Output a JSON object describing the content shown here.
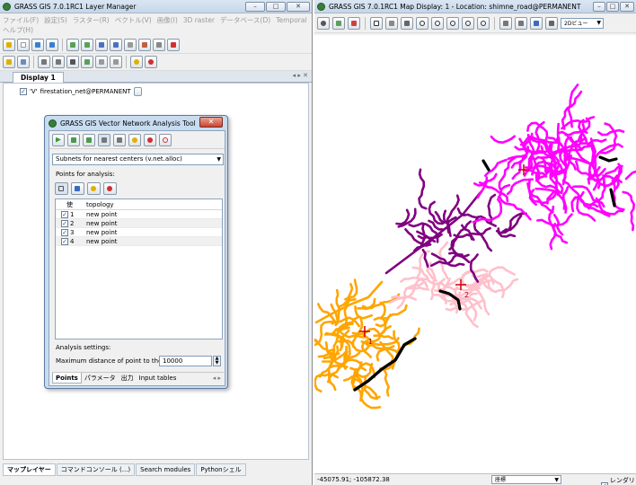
{
  "layer_manager": {
    "title": "GRASS GIS 7.0.1RC1 Layer Manager",
    "menu": [
      "ファイル(F)",
      "設定(S)",
      "ラスター(R)",
      "ベクトル(V)",
      "画像(I)",
      "3D raster",
      "データベース(D)",
      "Temporal",
      "ヘルプ(H)"
    ],
    "display_tab": "Display 1",
    "tab_controls": "◂ ▸ ✕",
    "layer": {
      "checked": "✓",
      "type": "'V'",
      "name": "firestation_net@PERMANENT"
    },
    "bottom_tabs": [
      "マップレイヤー",
      "コマンドコンソール (...)",
      "Search modules",
      "Pythonシェル"
    ]
  },
  "dialog": {
    "title": "GRASS GIS Vector Network Analysis Tool",
    "close": "✕",
    "analysis_select": "Subnets for nearest centers (v.net.alloc)",
    "points_label": "Points for analysis:",
    "columns": [
      "使",
      "topology"
    ],
    "points": [
      {
        "id": "1",
        "topology": "new point"
      },
      {
        "id": "2",
        "topology": "new point"
      },
      {
        "id": "3",
        "topology": "new point"
      },
      {
        "id": "4",
        "topology": "new point"
      }
    ],
    "settings_label": "Analysis settings:",
    "max_dist_label": "Maximum distance of point to the",
    "max_dist_value": "10000",
    "tabs": [
      "Points",
      "パラメータ",
      "出力",
      "Input tables"
    ]
  },
  "map_display": {
    "title": "GRASS GIS 7.0.1RC1 Map Display: 1  - Location: shimne_road@PERMANENT",
    "view_select": "2Dビュー",
    "coordinates": "-45075.91; -105872.38",
    "status_select": "座標",
    "render_label": "レンダリング",
    "point_labels": [
      "1",
      "2"
    ]
  },
  "colors": {
    "orange": "#ffa500",
    "pink": "#ffc0cb",
    "purple": "#800080",
    "magenta": "#ff00ff",
    "black": "#000000",
    "marker": "#cc0000"
  }
}
